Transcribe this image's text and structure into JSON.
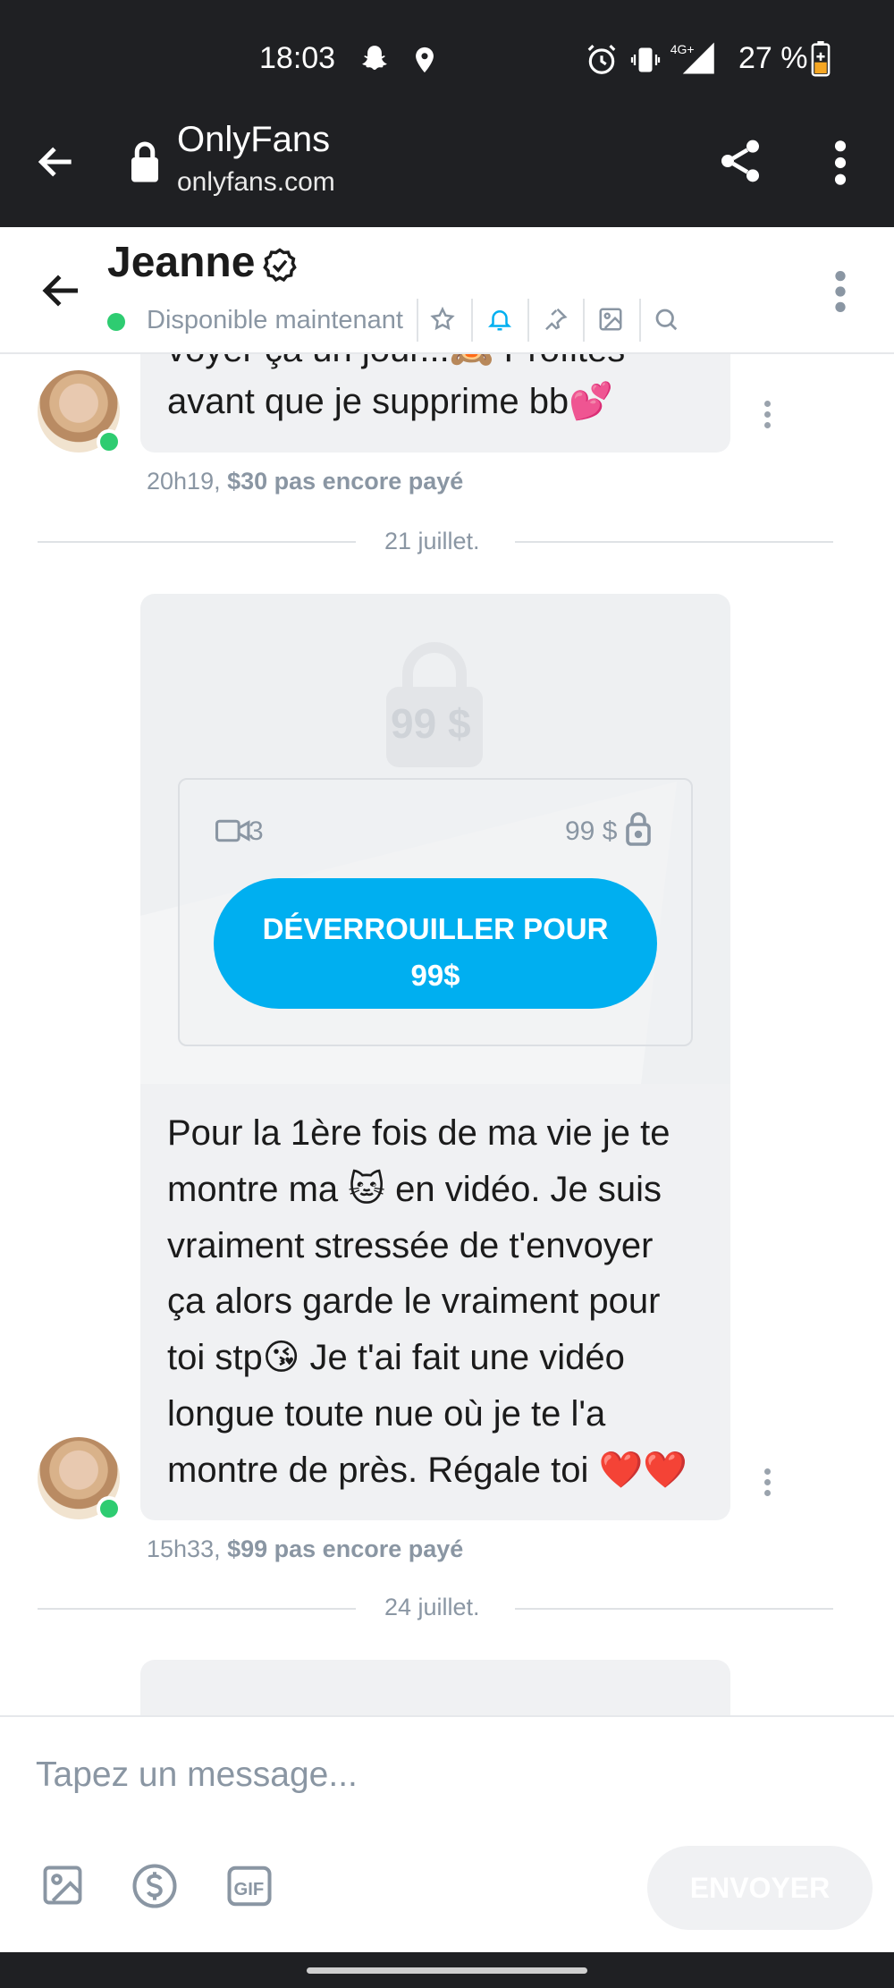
{
  "status_bar": {
    "time": "18:03",
    "network": "4G+",
    "battery": "27 %"
  },
  "browser": {
    "title": "OnlyFans",
    "url": "onlyfans.com"
  },
  "chat_header": {
    "name": "Jeanne",
    "status": "Disponible maintenant"
  },
  "messages": [
    {
      "text_line1": "voyer ça un jour...🙈 Profites",
      "text_line2": "avant que je supprime bb💕",
      "time": "20h19,",
      "price_status": "$30 pas encore payé"
    },
    {
      "date": "21 juillet."
    },
    {
      "locked_price_large": "99 $",
      "video_count": "3",
      "card_price": "99 $",
      "unlock_line1": "DÉVERROUILLER POUR",
      "unlock_line2": "99$",
      "lines": [
        "Pour la 1ère fois de ma vie je te",
        "montre ma 🐱 en vidéo. Je suis",
        "vraiment stressée de t'envoyer",
        "ça alors garde le vraiment pour",
        "toi stp😘 Je t'ai fait une vidéo",
        "longue toute nue où je te l'a",
        "montre de près. Régale toi ❤️❤️"
      ],
      "time": "15h33,",
      "price_status": "$99 pas encore payé"
    },
    {
      "date": "24 juillet."
    }
  ],
  "composer": {
    "placeholder": "Tapez un message...",
    "send_label": "ENVOYER",
    "gif_label": "GIF"
  },
  "colors": {
    "accent": "#00aff0",
    "online": "#2ecc71",
    "bubble": "#f0f1f3",
    "muted_text": "#8a96a3",
    "system_bar": "#1f2023"
  }
}
